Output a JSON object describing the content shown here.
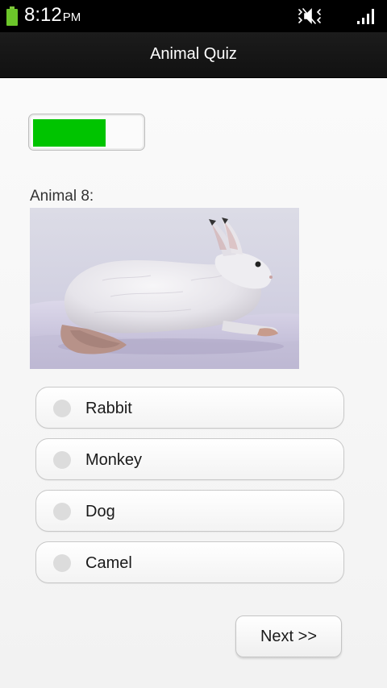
{
  "status_bar": {
    "time": "8:12",
    "ampm": "PM",
    "icons": [
      "battery-icon",
      "mute-icon",
      "signal-icon"
    ],
    "battery_color": "#6cc62a"
  },
  "header": {
    "title": "Animal Quiz"
  },
  "quiz": {
    "progress_fraction": 0.67,
    "progress_color": "#00c400",
    "question_label": "Animal 8:",
    "image_subject": "rabbit-in-snow",
    "options": [
      {
        "label": "Rabbit",
        "selected": false
      },
      {
        "label": "Monkey",
        "selected": false
      },
      {
        "label": "Dog",
        "selected": false
      },
      {
        "label": "Camel",
        "selected": false
      }
    ],
    "next_label": "Next >>"
  }
}
